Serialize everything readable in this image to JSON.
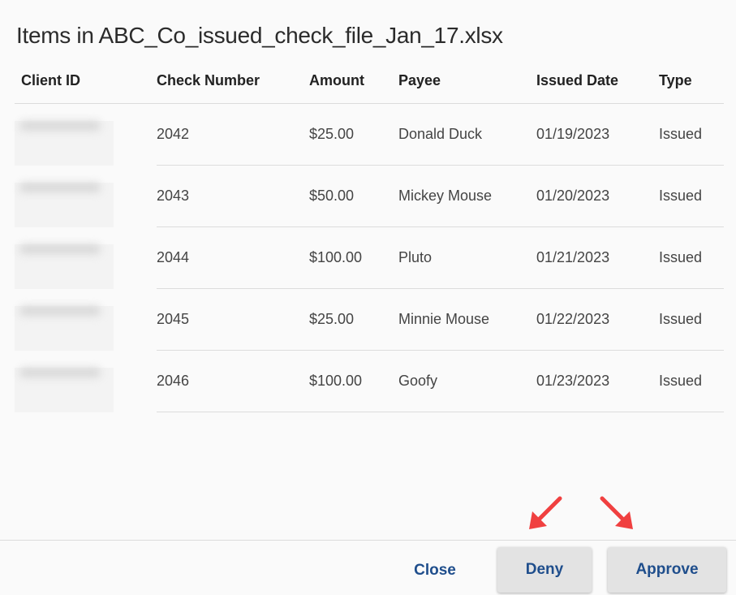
{
  "dialog": {
    "title": "Items in ABC_Co_issued_check_file_Jan_17.xlsx"
  },
  "table": {
    "headers": {
      "client_id": "Client ID",
      "check_number": "Check Number",
      "amount": "Amount",
      "payee": "Payee",
      "issued_date": "Issued Date",
      "type": "Type"
    },
    "rows": [
      {
        "check_number": "2042",
        "amount": "$25.00",
        "payee": "Donald Duck",
        "issued_date": "01/19/2023",
        "type": "Issued"
      },
      {
        "check_number": "2043",
        "amount": "$50.00",
        "payee": "Mickey Mouse",
        "issued_date": "01/20/2023",
        "type": "Issued"
      },
      {
        "check_number": "2044",
        "amount": "$100.00",
        "payee": "Pluto",
        "issued_date": "01/21/2023",
        "type": "Issued"
      },
      {
        "check_number": "2045",
        "amount": "$25.00",
        "payee": "Minnie Mouse",
        "issued_date": "01/22/2023",
        "type": "Issued"
      },
      {
        "check_number": "2046",
        "amount": "$100.00",
        "payee": "Goofy",
        "issued_date": "01/23/2023",
        "type": "Issued"
      }
    ]
  },
  "footer": {
    "close_label": "Close",
    "deny_label": "Deny",
    "approve_label": "Approve"
  },
  "colors": {
    "button_text": "#1f4e8c",
    "annotation_arrow": "#f04040"
  }
}
